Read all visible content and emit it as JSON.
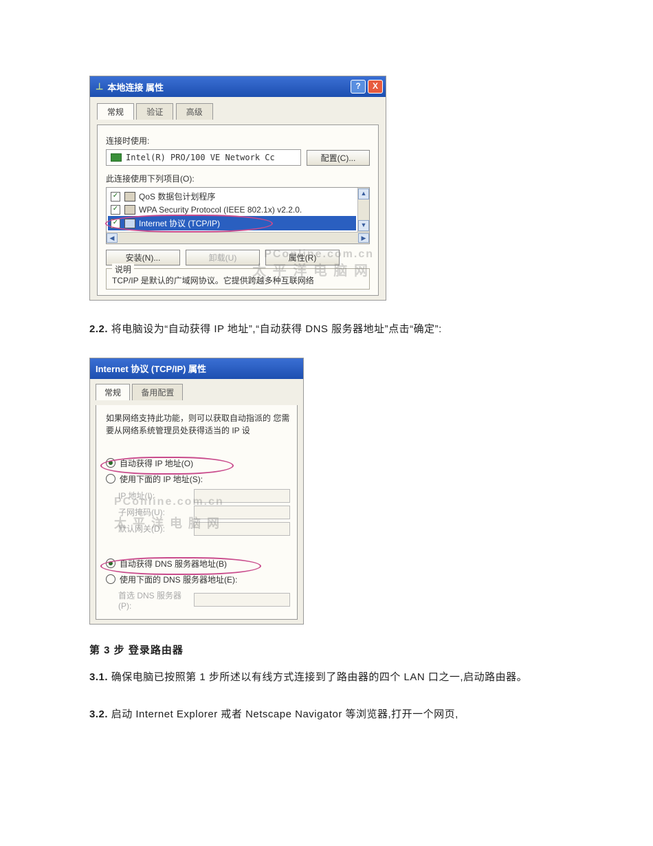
{
  "shot1": {
    "title_icon": "⊥",
    "title": "本地连接 属性",
    "tabs": [
      "常规",
      "验证",
      "高级"
    ],
    "connect_using_label": "连接时使用:",
    "nic_text": "Intel(R) PRO/100 VE Network Cc",
    "configure_btn": "配置(C)...",
    "uses_items_label": "此连接使用下列项目(O):",
    "items": [
      {
        "checked": true,
        "label": "QoS 数据包计划程序"
      },
      {
        "checked": true,
        "label": "WPA Security Protocol (IEEE 802.1x) v2.2.0."
      },
      {
        "checked": true,
        "label": "Internet 协议 (TCP/IP)",
        "selected": true
      }
    ],
    "install_btn": "安装(N)...",
    "uninstall_btn": "卸载(U)",
    "properties_btn": "属性(R)",
    "desc_group": "说明",
    "desc_text": "TCP/IP 是默认的广域网协议。它提供跨越多种互联网络",
    "watermark1": "PConline.com.cn",
    "watermark2": "太 平 洋 电 脑 网"
  },
  "para22": "2.2. 将电脑设为“自动获得 IP 地址”,“自动获得 DNS 服务器地址”点击“确定”:",
  "shot2": {
    "title": "Internet 协议 (TCP/IP) 属性",
    "tabs": [
      "常规",
      "备用配置"
    ],
    "desc": "如果网络支持此功能，则可以获取自动指派的\n您需要从网络系统管理员处获得适当的 IP 设",
    "r_auto_ip": "自动获得 IP 地址(O)",
    "r_manual_ip": "使用下面的 IP 地址(S):",
    "ip_label": "IP 地址(I):",
    "mask_label": "子网掩码(U):",
    "gw_label": "默认网关(D):",
    "r_auto_dns": "自动获得 DNS 服务器地址(B)",
    "r_manual_dns": "使用下面的 DNS 服务器地址(E):",
    "dns1_label": "首选 DNS 服务器(P):",
    "watermark1": "PConline.com.cn",
    "watermark2": "太 平 洋 电 脑 网"
  },
  "heading3": "第 3 步 登录路由器",
  "para31": "3.1. 确保电脑已按照第 1 步所述以有线方式连接到了路由器的四个 LAN 口之一,启动路由器。",
  "para32": "3.2. 启动 Internet Explorer 戒者 Netscape Navigator 等浏览器,打开一个网页,"
}
